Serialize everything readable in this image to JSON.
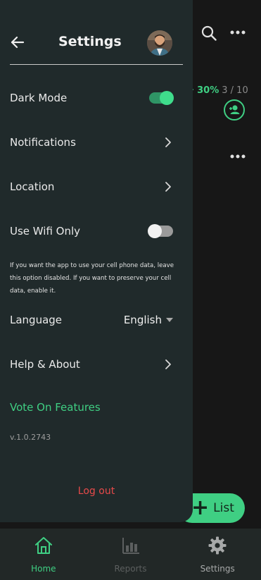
{
  "background": {
    "progress_percent": "30%",
    "progress_count": "3 / 10",
    "icons": [
      "search-icon",
      "more-icon",
      "add-user-icon",
      "more-icon"
    ],
    "fab_label": "List"
  },
  "drawer": {
    "title": "Settings",
    "back_icon": "arrow-left-icon",
    "items": {
      "dark_mode": {
        "label": "Dark Mode",
        "enabled": true
      },
      "notifications": {
        "label": "Notifications"
      },
      "location": {
        "label": "Location"
      },
      "wifi_only": {
        "label": "Use Wifi Only",
        "enabled": false
      },
      "wifi_note": "If you want the app to use your cell phone data, leave this option disabled. If you want to preserve your cell data, enable it.",
      "language": {
        "label": "Language",
        "value": "English"
      },
      "help": {
        "label": "Help & About"
      }
    },
    "vote_link": "Vote On Features",
    "version": "v.1.0.2743",
    "logout": "Log out"
  },
  "bottom_nav": {
    "items": [
      {
        "label": "Home",
        "icon": "home-icon",
        "state": "active"
      },
      {
        "label": "Reports",
        "icon": "bar-chart-icon",
        "state": "disabled"
      },
      {
        "label": "Settings",
        "icon": "gear-icon",
        "state": "normal"
      }
    ]
  },
  "colors": {
    "accent": "#3fcf83",
    "drawer_bg": "#202a2b",
    "page_bg": "#171717",
    "danger": "#e84a4a"
  }
}
